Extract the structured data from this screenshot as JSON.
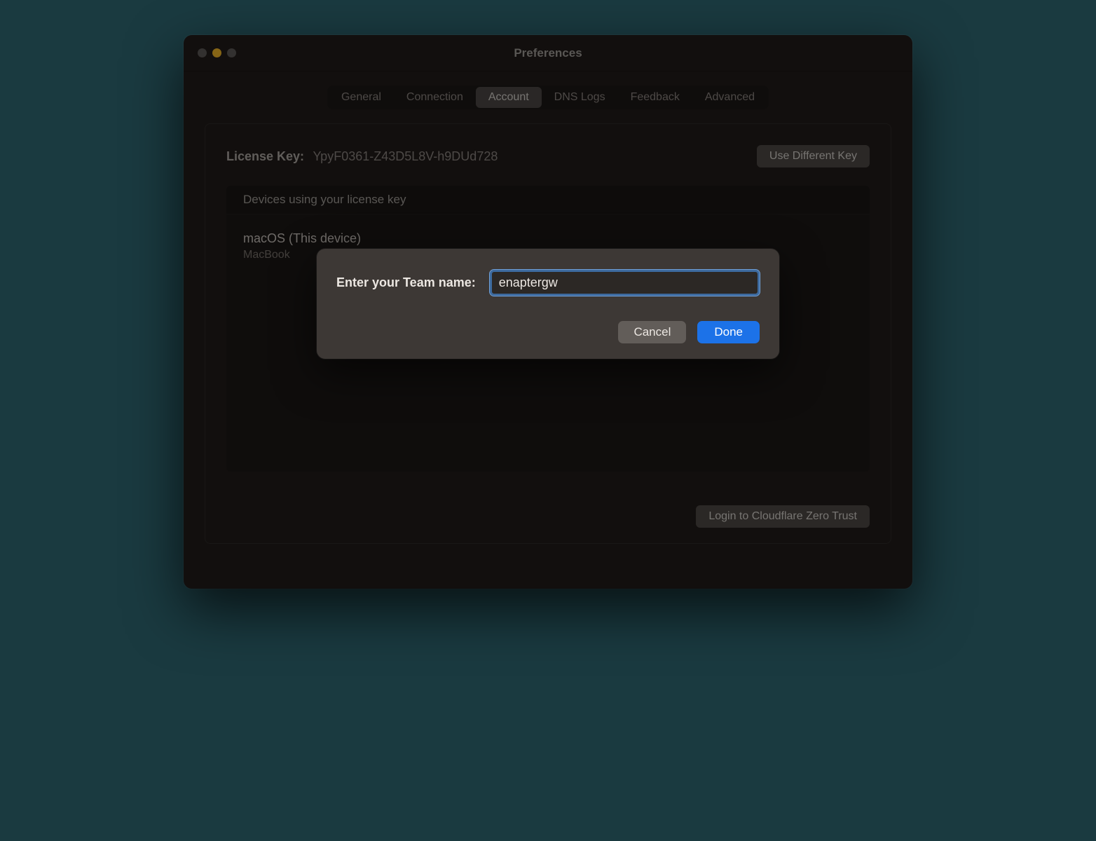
{
  "window": {
    "title": "Preferences"
  },
  "tabs": {
    "general": "General",
    "connection": "Connection",
    "account": "Account",
    "dns_logs": "DNS Logs",
    "feedback": "Feedback",
    "advanced": "Advanced"
  },
  "license": {
    "label": "License Key:",
    "value": "YpyF0361-Z43D5L8V-h9DUd728",
    "change_button": "Use Different Key"
  },
  "devices": {
    "header": "Devices using your license key",
    "items": [
      {
        "name": "macOS (This device)",
        "sub": "MacBook"
      }
    ]
  },
  "footer": {
    "login_button": "Login to Cloudflare Zero Trust"
  },
  "dialog": {
    "label": "Enter your Team name:",
    "value": "enaptergw",
    "cancel": "Cancel",
    "done": "Done"
  }
}
